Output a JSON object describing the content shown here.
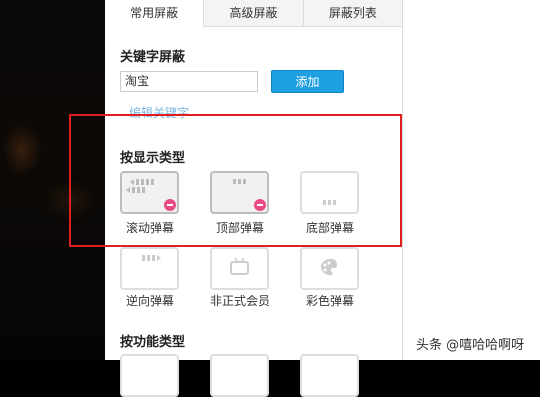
{
  "tabs": [
    {
      "label": "常用屏蔽",
      "active": true
    },
    {
      "label": "高级屏蔽",
      "active": false
    },
    {
      "label": "屏蔽列表",
      "active": false
    }
  ],
  "keyword": {
    "title": "关键字屏蔽",
    "input_value": "淘宝",
    "add_label": "添加",
    "edit_label": "编辑关键字"
  },
  "display_type": {
    "title": "按显示类型",
    "items": [
      {
        "label": "滚动弹幕",
        "icon": "scroll-danmaku-icon",
        "blocked": true
      },
      {
        "label": "顶部弹幕",
        "icon": "top-danmaku-icon",
        "blocked": true
      },
      {
        "label": "底部弹幕",
        "icon": "bottom-danmaku-icon",
        "blocked": false
      },
      {
        "label": "逆向弹幕",
        "icon": "reverse-danmaku-icon",
        "blocked": false
      },
      {
        "label": "非正式会员",
        "icon": "tv-icon",
        "blocked": false
      },
      {
        "label": "彩色弹幕",
        "icon": "palette-icon",
        "blocked": false
      }
    ]
  },
  "function_type": {
    "title": "按功能类型"
  },
  "watermark": "头条 @嘻哈哈啊呀",
  "colors": {
    "accent": "#1fa0e3",
    "badge": "#e94a86",
    "highlight": "#e02020"
  }
}
